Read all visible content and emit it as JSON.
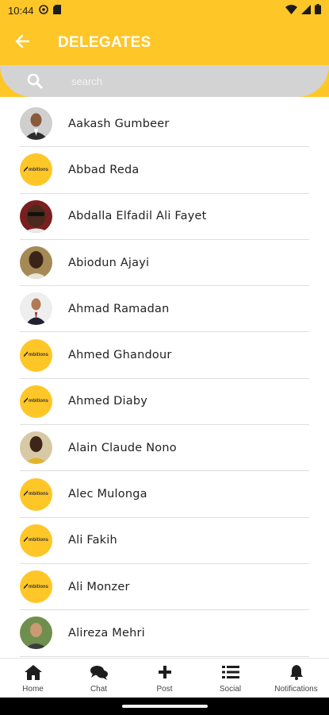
{
  "status_bar": {
    "time": "10:44",
    "icons": [
      "at-sign-icon",
      "sd-card-icon",
      "wifi-icon",
      "signal-icon",
      "battery-icon"
    ]
  },
  "header": {
    "title": "DELEGATES",
    "back_icon": "arrow-left-icon",
    "background_color": "#ffc628"
  },
  "search": {
    "placeholder": "search",
    "icon": "search-icon"
  },
  "delegates": [
    {
      "name": "Aakash Gumbeer",
      "avatar": "photo"
    },
    {
      "name": "Abbad Reda",
      "avatar": "logo"
    },
    {
      "name": "Abdalla Elfadil Ali Fayet",
      "avatar": "photo"
    },
    {
      "name": "Abiodun Ajayi",
      "avatar": "photo"
    },
    {
      "name": "Ahmad Ramadan",
      "avatar": "photo"
    },
    {
      "name": "Ahmed Ghandour",
      "avatar": "logo"
    },
    {
      "name": "Ahmed Diaby",
      "avatar": "logo"
    },
    {
      "name": "Alain Claude Nono",
      "avatar": "photo"
    },
    {
      "name": "Alec Mulonga",
      "avatar": "logo"
    },
    {
      "name": "Ali Fakih",
      "avatar": "logo"
    },
    {
      "name": "Ali Monzer",
      "avatar": "logo"
    },
    {
      "name": "Alireza Mehri",
      "avatar": "photo"
    }
  ],
  "bottom_nav": [
    {
      "label": "Home",
      "icon": "home-icon"
    },
    {
      "label": "Chat",
      "icon": "chat-icon"
    },
    {
      "label": "Post",
      "icon": "plus-icon"
    },
    {
      "label": "Social",
      "icon": "list-icon"
    },
    {
      "label": "Notifications",
      "icon": "bell-icon"
    }
  ]
}
